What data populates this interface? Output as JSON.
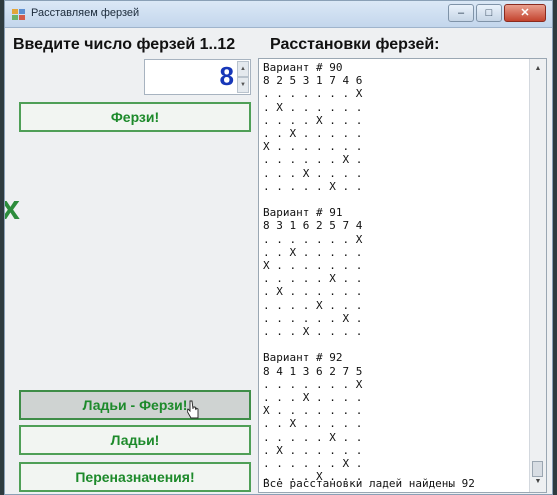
{
  "window": {
    "title": "Расставляем ферзей",
    "controls": {
      "minimize": "–",
      "maximize": "□",
      "close": "✕"
    }
  },
  "labels": {
    "count_prompt": "Введите число ферзей 1..12",
    "solutions_heading": "Расстановки ферзей:"
  },
  "spin": {
    "value": "8",
    "up": "▲",
    "down": "▼"
  },
  "buttons": {
    "queens": "Ферзи!",
    "rooks_queens": "Ладьи - Ферзи!",
    "rooks": "Ладьи!",
    "reassign": "Переназначения!"
  },
  "output": {
    "text": "Вариант # 90\n8 2 5 3 1 7 4 6\n. . . . . . . X\n. X . . . . . .\n. . . . X . . .\n. . X . . . . .\nX . . . . . . .\n. . . . . . X .\n. . . X . . . .\n. . . . . X . .\n\nВариант # 91\n8 3 1 6 2 5 7 4\n. . . . . . . X\n. . X . . . . .\nX . . . . . . .\n. . . . . X . .\n. X . . . . . .\n. . . . X . . .\n. . . . . . X .\n. . . X . . . .\n\nВариант # 92\n8 4 1 3 6 2 7 5\n. . . . . . . X\n. . . X . . . .\nX . . . . . . .\n. . X . . . . .\n. . . . . X . .\n. X . . . . . .\n. . . . . . X .\n. . . . X . . .",
    "footer": "Все расстановки ладей найдены 92"
  },
  "icons": {
    "edge_mark": "x"
  }
}
